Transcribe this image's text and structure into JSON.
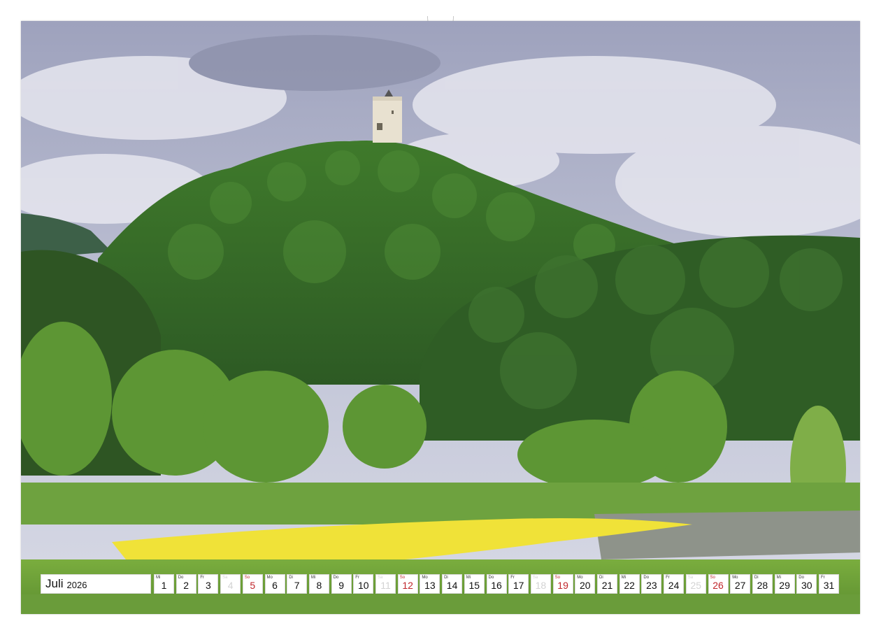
{
  "calendar": {
    "month": "Juli",
    "year": "2026",
    "days": [
      {
        "wd": "Mi",
        "num": "1",
        "type": "normal"
      },
      {
        "wd": "Do",
        "num": "2",
        "type": "normal"
      },
      {
        "wd": "Fr",
        "num": "3",
        "type": "normal"
      },
      {
        "wd": "Sa",
        "num": "4",
        "type": "holiday"
      },
      {
        "wd": "So",
        "num": "5",
        "type": "sun"
      },
      {
        "wd": "Mo",
        "num": "6",
        "type": "normal"
      },
      {
        "wd": "Di",
        "num": "7",
        "type": "normal"
      },
      {
        "wd": "Mi",
        "num": "8",
        "type": "normal"
      },
      {
        "wd": "Do",
        "num": "9",
        "type": "normal"
      },
      {
        "wd": "Fr",
        "num": "10",
        "type": "normal"
      },
      {
        "wd": "Sa",
        "num": "11",
        "type": "holiday"
      },
      {
        "wd": "So",
        "num": "12",
        "type": "sun"
      },
      {
        "wd": "Mo",
        "num": "13",
        "type": "normal"
      },
      {
        "wd": "Di",
        "num": "14",
        "type": "normal"
      },
      {
        "wd": "Mi",
        "num": "15",
        "type": "normal"
      },
      {
        "wd": "Do",
        "num": "16",
        "type": "normal"
      },
      {
        "wd": "Fr",
        "num": "17",
        "type": "normal"
      },
      {
        "wd": "Sa",
        "num": "18",
        "type": "holiday"
      },
      {
        "wd": "So",
        "num": "19",
        "type": "sun"
      },
      {
        "wd": "Mo",
        "num": "20",
        "type": "normal"
      },
      {
        "wd": "Di",
        "num": "21",
        "type": "normal"
      },
      {
        "wd": "Mi",
        "num": "22",
        "type": "normal"
      },
      {
        "wd": "Do",
        "num": "23",
        "type": "normal"
      },
      {
        "wd": "Fr",
        "num": "24",
        "type": "normal"
      },
      {
        "wd": "Sa",
        "num": "25",
        "type": "holiday"
      },
      {
        "wd": "So",
        "num": "26",
        "type": "sun"
      },
      {
        "wd": "Mo",
        "num": "27",
        "type": "normal"
      },
      {
        "wd": "Di",
        "num": "28",
        "type": "normal"
      },
      {
        "wd": "Mi",
        "num": "29",
        "type": "normal"
      },
      {
        "wd": "Do",
        "num": "30",
        "type": "normal"
      },
      {
        "wd": "Fr",
        "num": "31",
        "type": "normal"
      }
    ]
  },
  "photo": {
    "subject": "hilltop-tower-landscape",
    "colors": {
      "sky": "#b9bcd0",
      "cloud": "#e4e4ee",
      "forest_dark": "#2f5a26",
      "forest_mid": "#4c7f33",
      "meadow": "#6ea23f",
      "flowers": "#f1e43a",
      "water": "#8e938a",
      "tower": "#e6dfcf"
    }
  },
  "colors": {
    "sunday": "#c0262b",
    "saturday": "#d3d3d3",
    "binding": "#9a9a9a"
  }
}
